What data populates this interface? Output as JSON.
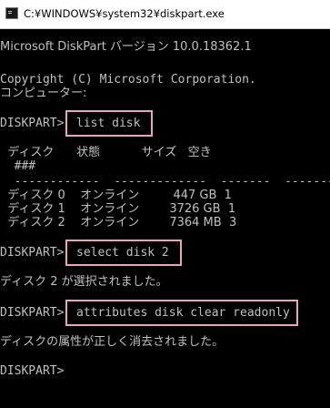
{
  "window": {
    "title": "C:¥WINDOWS¥system32¥diskpart.exe",
    "icon": "console-icon"
  },
  "console": {
    "banner": "Microsoft DiskPart バージョン 10.0.18362.1",
    "copyright": "Copyright (C) Microsoft Corporation.",
    "computer_label": "コンピューター:",
    "prompt": "DISKPART>",
    "commands": [
      "list disk",
      "select disk 2",
      "attributes disk clear readonly"
    ],
    "disk_table": {
      "headers": [
        "ディスク ###",
        "状態",
        "サイズ",
        "空き"
      ],
      "header_line_1": "  ディスク      状態           サイズ   空き",
      "header_line_2": "  ###",
      "separator": "  ------------  -------------  -------  -------",
      "rows": [
        {
          "disk": "ディスク 0",
          "status": "オンライン",
          "size": "447 GB",
          "free": "1"
        },
        {
          "disk": "ディスク 1",
          "status": "オンライン",
          "size": "3726 GB",
          "free": "1"
        },
        {
          "disk": "ディスク 2",
          "status": "オンライン",
          "size": "7364 MB",
          "free": "3"
        }
      ],
      "row_lines": [
        "  ディスク 0    オンライン         447 GB  1",
        "  ディスク 1    オンライン        3726 GB  1",
        "  ディスク 2    オンライン        7364 MB  3"
      ]
    },
    "responses": [
      "ディスク 2 が選択されました。",
      "ディスクの属性が正しく消去されました。"
    ],
    "highlight_color": "#e8a3c8"
  }
}
